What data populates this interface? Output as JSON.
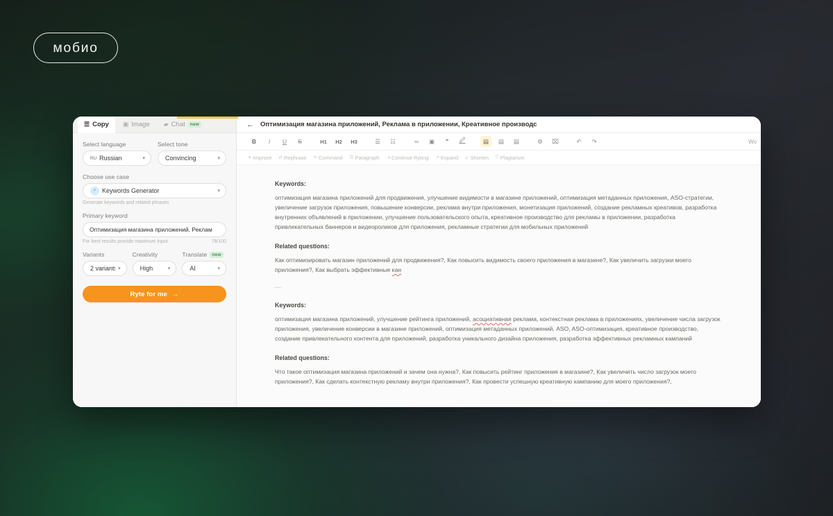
{
  "brand": {
    "logo_text": "мобио"
  },
  "colors": {
    "accent_orange": "#f7941d",
    "tab_badge_green": "#4e8f57",
    "toolbar_active": "#fdf4d6",
    "spellcheck_red": "#e8665a",
    "top_accent_yellow": "#f2c94c"
  },
  "left_panel": {
    "tabs": [
      {
        "label": "Copy",
        "icon": "lines-icon",
        "badge": null,
        "active": true
      },
      {
        "label": "Image",
        "icon": "image-icon",
        "badge": null,
        "active": false
      },
      {
        "label": "Chat",
        "icon": "chat-icon",
        "badge": "new",
        "active": false
      }
    ],
    "select_language": {
      "label": "Select language",
      "flag": "RU",
      "value": "Russian"
    },
    "select_tone": {
      "label": "Select tone",
      "value": "Convincing"
    },
    "use_case": {
      "label": "Choose use case",
      "value": "Keywords Generator",
      "icon": "magnifier-icon",
      "hint": "Generate keywords and related phrases"
    },
    "primary_keyword": {
      "label": "Primary keyword",
      "value": "Оптимизация магазина приложений, Реклам",
      "hint": "For best results provide maximum input",
      "counter": "78/100"
    },
    "variants": {
      "label": "Variants",
      "value": "2 variants"
    },
    "creativity": {
      "label": "Creativity",
      "value": "High"
    },
    "translate": {
      "label": "Translate",
      "badge": "new",
      "value": "AI"
    },
    "submit_button": {
      "label": "Ryte for me",
      "arrow": "→"
    }
  },
  "editor": {
    "back_arrow": "←",
    "doc_title": "Оптимизация магазина приложений, Реклама в приложении, Креативное производс",
    "word_count": "Wo",
    "format_toolbar": [
      {
        "name": "bold-button",
        "label": "B",
        "style": "strong",
        "active": false
      },
      {
        "name": "italic-button",
        "label": "I",
        "style": "ital",
        "active": false
      },
      {
        "name": "underline-button",
        "label": "U",
        "style": "und",
        "active": false
      },
      {
        "name": "strikethrough-button",
        "label": "S",
        "style": "strike",
        "active": false
      },
      {
        "name": "heading-1-button",
        "label": "H1",
        "style": "heading",
        "active": false
      },
      {
        "name": "heading-2-button",
        "label": "H2",
        "style": "heading",
        "active": false
      },
      {
        "name": "heading-3-button",
        "label": "H3",
        "style": "heading",
        "active": false
      },
      {
        "name": "bullet-list-button",
        "label": "☰",
        "style": "",
        "active": false
      },
      {
        "name": "numbered-list-button",
        "label": "☷",
        "style": "",
        "active": false
      },
      {
        "name": "link-button",
        "label": "∞",
        "style": "",
        "active": false
      },
      {
        "name": "insert-image-button",
        "label": "▣",
        "style": "",
        "active": false
      },
      {
        "name": "quote-button",
        "label": "❞",
        "style": "",
        "active": false
      },
      {
        "name": "highlighter-button",
        "label": "🖉",
        "style": "",
        "active": false
      },
      {
        "name": "align-left-button",
        "label": "▤",
        "style": "",
        "active": true
      },
      {
        "name": "align-center-button",
        "label": "▤",
        "style": "",
        "active": false
      },
      {
        "name": "align-right-button",
        "label": "▤",
        "style": "",
        "active": false
      },
      {
        "name": "settings-button",
        "label": "⚙",
        "style": "",
        "active": false
      },
      {
        "name": "clear-format-button",
        "label": "⌧",
        "style": "",
        "active": false
      },
      {
        "name": "undo-button",
        "label": "↶",
        "style": "",
        "active": false
      },
      {
        "name": "redo-button",
        "label": "↷",
        "style": "",
        "active": false
      }
    ],
    "ai_toolbar": [
      {
        "label": "Improve",
        "icon": "sparkle-icon"
      },
      {
        "label": "Rephrase",
        "icon": "swap-icon"
      },
      {
        "label": "Command",
        "icon": "wand-icon"
      },
      {
        "label": "Paragraph",
        "icon": "paragraph-icon"
      },
      {
        "label": "Continue Ryting",
        "icon": "arrow-right-icon"
      },
      {
        "label": "Expand",
        "icon": "expand-icon"
      },
      {
        "label": "Shorten",
        "icon": "shorten-icon"
      },
      {
        "label": "Plagiarism",
        "icon": "shield-icon"
      }
    ],
    "document": {
      "blocks": [
        {
          "type": "heading",
          "text": "Keywords:"
        },
        {
          "type": "paragraph",
          "text": "оптимизация магазина приложений для продвижения, улучшение видимости в магазине приложений, оптимизация метаданных приложения, ASO-стратегии, увеличение загрузок приложения, повышение конверсии, реклама внутри приложения, монетизация приложений, создание рекламных креативов, разработка внутренних объявлений в приложении, улучшение пользовательского опыта, креативное производство для рекламы в приложении, разработка привлекательных баннеров и видеороликов для приложения, рекламные стратегии для мобильных приложений"
        },
        {
          "type": "heading",
          "text": "Related questions:"
        },
        {
          "type": "paragraph",
          "text": "Как оптимизировать магазин приложений для продвижения?, Как повысить видимость своего приложения в магазине?, Как увеличить загрузки моего приложения?, Как выбрать эффективные ",
          "misspelled_tail": "кан"
        },
        {
          "type": "separator",
          "text": "—"
        },
        {
          "type": "heading",
          "text": "Keywords:"
        },
        {
          "type": "paragraph",
          "text_before": "оптимизация магазина приложений, улучшение рейтинга приложений, ",
          "misspelled": "асоциативная",
          "text_after": " реклама, контекстная реклама в приложениях, увеличение числа загрузок приложения, увеличение конверсии в магазине приложений, оптимизация метаданных приложений, ASO, ASO-оптимизация, креативное производство, создание привлекательного контента для приложений, разработка уникального дизайна приложения, разработка эффективных рекламных кампаний"
        },
        {
          "type": "heading",
          "text": "Related questions:"
        },
        {
          "type": "paragraph",
          "text": "Что такое оптимизация магазина приложений и зачем она нужна?, Как повысить рейтинг приложения в магазине?, Как увеличить число загрузок моего приложения?, Как сделать контекстную рекламу внутри приложения?, Как провести успешную креативную кампанию для моего приложения?,"
        }
      ]
    }
  }
}
